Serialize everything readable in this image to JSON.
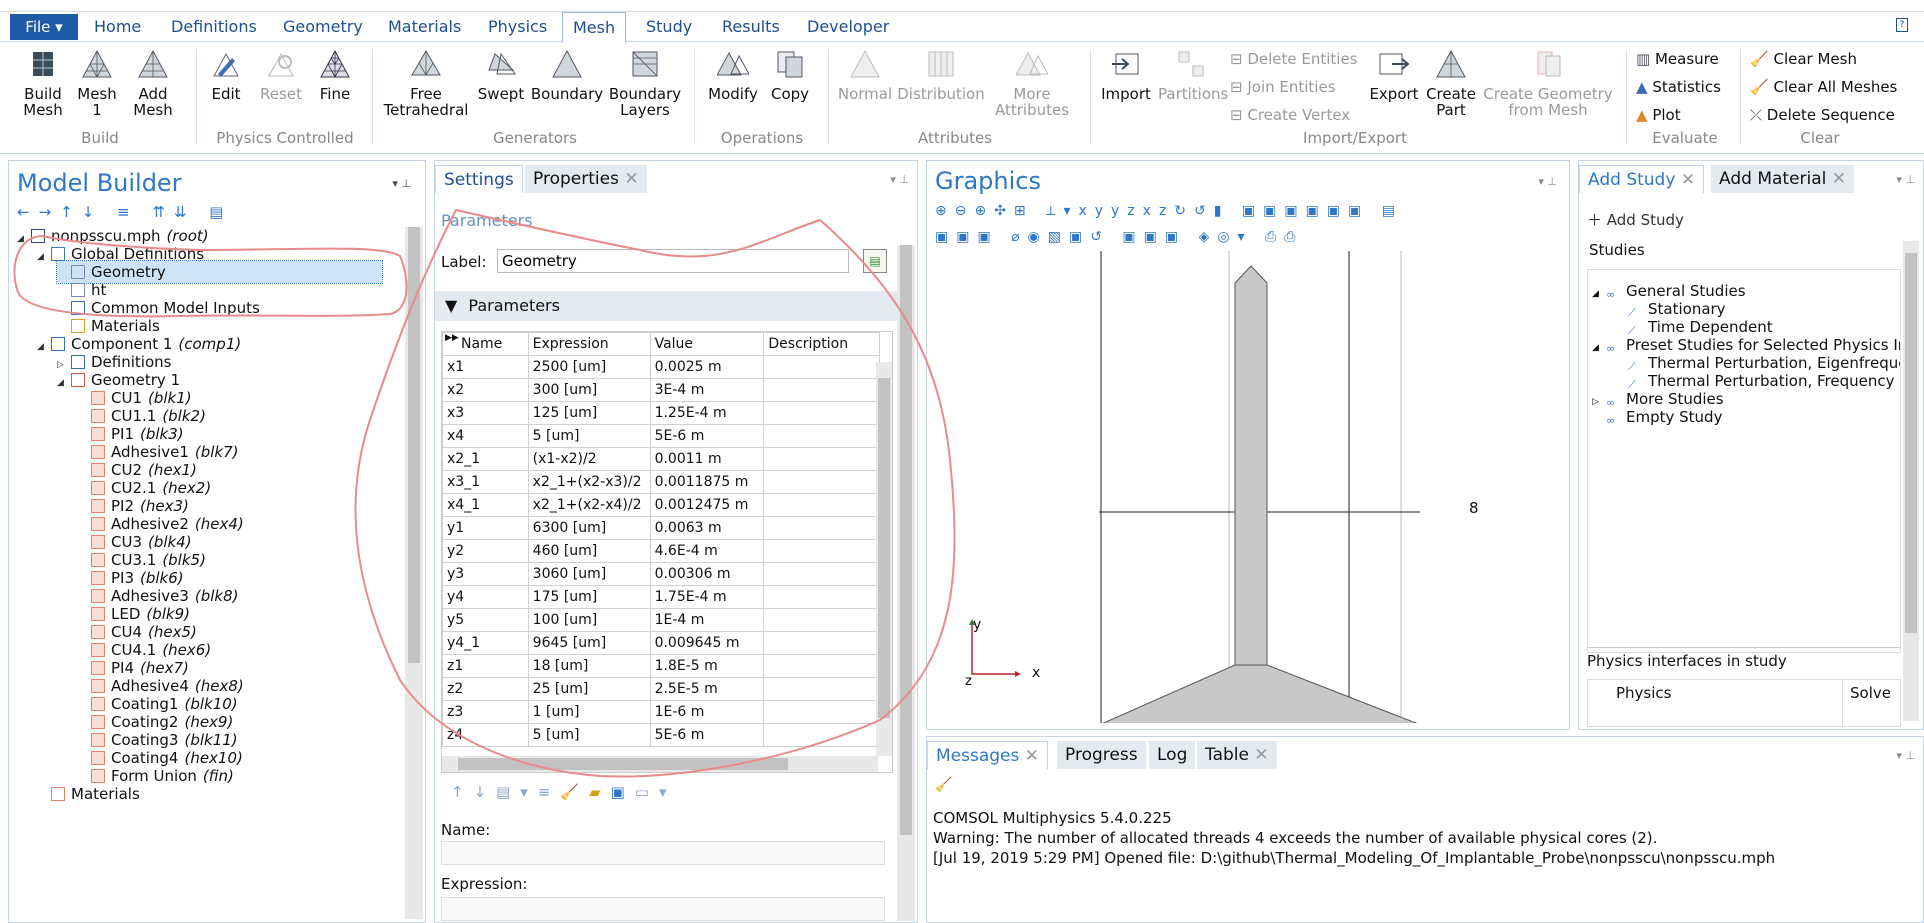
{
  "ribbon_tabs": {
    "file": "File",
    "t1": "Home",
    "t2": "Definitions",
    "t3": "Geometry",
    "t4": "Materials",
    "t5": "Physics",
    "t6": "Mesh",
    "t7": "Study",
    "t8": "Results",
    "t9": "Developer"
  },
  "ribbon": {
    "build_mesh": "Build Mesh",
    "mesh1": "Mesh 1",
    "add_mesh": "Add Mesh",
    "edit": "Edit",
    "reset": "Reset",
    "fine": "Fine",
    "free_tet": "Free Tetrahedral",
    "swept": "Swept",
    "boundary": "Boundary",
    "boundary_layers": "Boundary Layers",
    "modify": "Modify",
    "copy": "Copy",
    "normal": "Normal",
    "distribution": "Distribution",
    "more_attr": "More Attributes",
    "import": "Import",
    "partitions": "Partitions",
    "delete_entities": "Delete Entities",
    "join_entities": "Join Entities",
    "create_vertex": "Create Vertex",
    "export": "Export",
    "create_part": "Create Part",
    "create_geom": "Create Geometry from Mesh",
    "measure": "Measure",
    "statistics": "Statistics",
    "plot": "Plot",
    "clear_mesh": "Clear Mesh",
    "clear_all": "Clear All Meshes",
    "delete_seq": "Delete Sequence",
    "g_build": "Build",
    "g_physics": "Physics Controlled",
    "g_generators": "Generators",
    "g_operations": "Operations",
    "g_attributes": "Attributes",
    "g_importexport": "Import/Export",
    "g_evaluate": "Evaluate",
    "g_clear": "Clear"
  },
  "model_builder": {
    "title": "Model Builder",
    "tree": [
      {
        "label": "nonpsscu.mph",
        "tag": "(root)"
      },
      {
        "label": "Global Definitions",
        "tag": ""
      },
      {
        "label": "Geometry",
        "tag": ""
      },
      {
        "label": "ht",
        "tag": ""
      },
      {
        "label": "Common Model Inputs",
        "tag": ""
      },
      {
        "label": "Materials",
        "tag": ""
      },
      {
        "label": "Component 1",
        "tag": "(comp1)"
      },
      {
        "label": "Definitions",
        "tag": ""
      },
      {
        "label": "Geometry 1",
        "tag": ""
      },
      {
        "label": "CU1",
        "tag": "(blk1)"
      },
      {
        "label": "CU1.1",
        "tag": "(blk2)"
      },
      {
        "label": "PI1",
        "tag": "(blk3)"
      },
      {
        "label": "Adhesive1",
        "tag": "(blk7)"
      },
      {
        "label": "CU2",
        "tag": "(hex1)"
      },
      {
        "label": "CU2.1",
        "tag": "(hex2)"
      },
      {
        "label": "PI2",
        "tag": "(hex3)"
      },
      {
        "label": "Adhesive2",
        "tag": "(hex4)"
      },
      {
        "label": "CU3",
        "tag": "(blk4)"
      },
      {
        "label": "CU3.1",
        "tag": "(blk5)"
      },
      {
        "label": "PI3",
        "tag": "(blk6)"
      },
      {
        "label": "Adhesive3",
        "tag": "(blk8)"
      },
      {
        "label": "LED",
        "tag": "(blk9)"
      },
      {
        "label": "CU4",
        "tag": "(hex5)"
      },
      {
        "label": "CU4.1",
        "tag": "(hex6)"
      },
      {
        "label": "PI4",
        "tag": "(hex7)"
      },
      {
        "label": "Adhesive4",
        "tag": "(hex8)"
      },
      {
        "label": "Coating1",
        "tag": "(blk10)"
      },
      {
        "label": "Coating2",
        "tag": "(hex9)"
      },
      {
        "label": "Coating3",
        "tag": "(blk11)"
      },
      {
        "label": "Coating4",
        "tag": "(hex10)"
      },
      {
        "label": "Form Union",
        "tag": "(fin)"
      },
      {
        "label": "Materials",
        "tag": ""
      }
    ]
  },
  "settings": {
    "tab_settings": "Settings",
    "tab_properties": "Properties",
    "section": "Parameters",
    "label_caption": "Label:",
    "label_value": "Geometry",
    "params_header": "Parameters",
    "columns": [
      "Name",
      "Expression",
      "Value",
      "Description"
    ],
    "rows": [
      [
        "x1",
        "2500 [um]",
        "0.0025 m",
        ""
      ],
      [
        "x2",
        "300 [um]",
        "3E-4 m",
        ""
      ],
      [
        "x3",
        "125 [um]",
        "1.25E-4 m",
        ""
      ],
      [
        "x4",
        "5 [um]",
        "5E-6 m",
        ""
      ],
      [
        "x2_1",
        "(x1-x2)/2",
        "0.0011 m",
        ""
      ],
      [
        "x3_1",
        "x2_1+(x2-x3)/2",
        "0.0011875 m",
        ""
      ],
      [
        "x4_1",
        "x2_1+(x2-x4)/2",
        "0.0012475 m",
        ""
      ],
      [
        "y1",
        "6300 [um]",
        "0.0063 m",
        ""
      ],
      [
        "y2",
        "460 [um]",
        "4.6E-4 m",
        ""
      ],
      [
        "y3",
        "3060 [um]",
        "0.00306 m",
        ""
      ],
      [
        "y4",
        "175 [um]",
        "1.75E-4 m",
        ""
      ],
      [
        "y5",
        "100 [um]",
        "1E-4 m",
        ""
      ],
      [
        "y4_1",
        "9645 [um]",
        "0.009645 m",
        ""
      ],
      [
        "z1",
        "18 [um]",
        "1.8E-5 m",
        ""
      ],
      [
        "z2",
        "25 [um]",
        "2.5E-5 m",
        ""
      ],
      [
        "z3",
        "1 [um]",
        "1E-6 m",
        ""
      ],
      [
        "z4",
        "5 [um]",
        "5E-6 m",
        ""
      ]
    ],
    "name_caption": "Name:",
    "expression_caption": "Expression:"
  },
  "graphics": {
    "title": "Graphics",
    "axis_label": "8",
    "axis_y": "y",
    "axis_z": "z",
    "axis_x": "x"
  },
  "add_study": {
    "tab_study": "Add Study",
    "tab_material": "Add Material",
    "add_btn": "Add Study",
    "studies_header": "Studies",
    "items": [
      "General Studies",
      "Stationary",
      "Time Dependent",
      "Preset Studies for Selected Physics In",
      "Thermal Perturbation, Eigenfreque",
      "Thermal Perturbation, Frequency",
      "More Studies",
      "Empty Study"
    ],
    "physics_header": "Physics interfaces in study",
    "col_physics": "Physics",
    "col_solve": "Solve"
  },
  "messages": {
    "tabs": [
      "Messages",
      "Progress",
      "Log",
      "Table"
    ],
    "lines": [
      "COMSOL Multiphysics 5.4.0.225",
      "Warning: The number of allocated threads 4 exceeds the number of available physical cores (2).",
      "[Jul 19, 2019 5:29 PM] Opened file: D:\\github\\Thermal_Modeling_Of_Implantable_Probe\\nonpsscu\\nonpsscu.mph"
    ]
  },
  "colors": {
    "accent": "#2f77c8",
    "file_blue": "#1f5aa8",
    "annotation": "#e88a8a",
    "selection": "#cde3f7"
  }
}
